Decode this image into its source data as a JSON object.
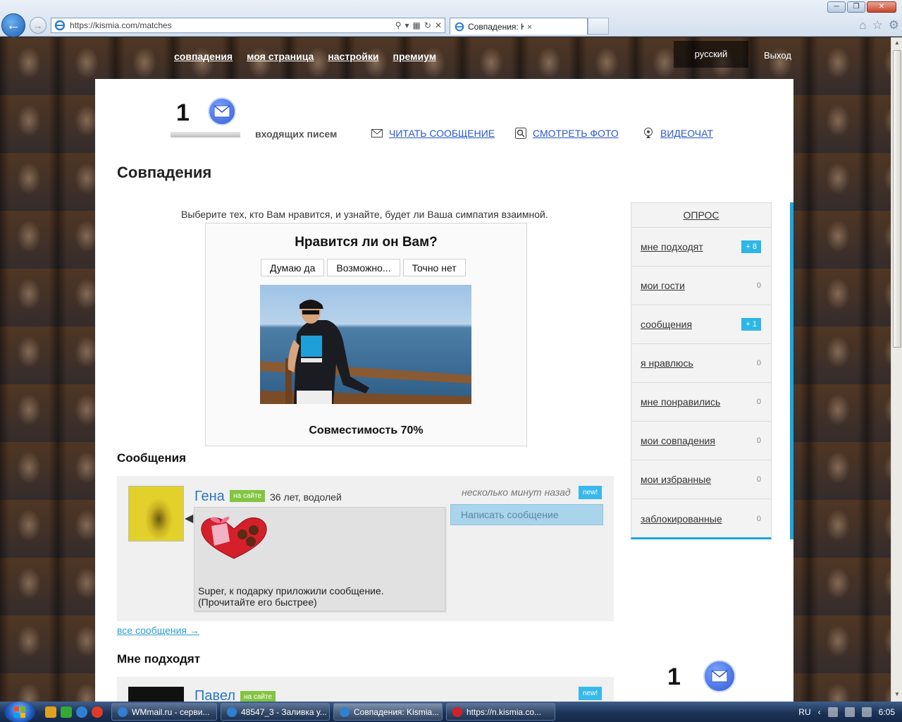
{
  "browser": {
    "url": "https://kismia.com/matches",
    "tab_title": "Совпадения: Kismia",
    "tab_close": "×"
  },
  "site": {
    "nav": [
      "совпадения",
      "моя страница",
      "настройки",
      "премиум"
    ],
    "language": "русский",
    "logout": "Выход"
  },
  "mailbox": {
    "count": "1",
    "label": "входящих писем",
    "links": {
      "read": "ЧИТАТЬ СООБЩЕНИЕ",
      "photo": "СМОТРЕТЬ ФОТО",
      "video": "ВИДЕОЧАТ"
    }
  },
  "page": {
    "title": "Совпадения",
    "intro": "Выберите тех, кто Вам нравится, и узнайте, будет ли Ваша симпатия взаимной."
  },
  "quiz": {
    "question": "Нравится ли он Вам?",
    "buttons": [
      "Думаю да",
      "Возможно...",
      "Точно нет"
    ],
    "compatibility": "Совместимость 70%"
  },
  "sidebar": {
    "title": "ОПРОС",
    "items": [
      {
        "label": "мне подходят",
        "badge": "+ 8",
        "hot": true
      },
      {
        "label": "мои гости",
        "badge": "0",
        "hot": false
      },
      {
        "label": "сообщения",
        "badge": "+ 1",
        "hot": true
      },
      {
        "label": "я нравлюсь",
        "badge": "0",
        "hot": false
      },
      {
        "label": "мне понравились",
        "badge": "0",
        "hot": false
      },
      {
        "label": "мои совпадения",
        "badge": "0",
        "hot": false
      },
      {
        "label": "мои избранные",
        "badge": "0",
        "hot": false
      },
      {
        "label": "заблокированные",
        "badge": "0",
        "hot": false
      }
    ]
  },
  "messages": {
    "heading": "Сообщения",
    "item": {
      "name": "Гена",
      "online": "на сайте",
      "info": "36 лет, водолей",
      "time": "несколько минут назад",
      "new": "new!",
      "reply": "Написать сообщение",
      "text_line1": "Super, к подарку приложили сообщение.",
      "text_line2": "(Прочитайте его быстрее)"
    },
    "all_link": "все сообщения →"
  },
  "matches": {
    "heading": "Мне подходят",
    "item": {
      "name": "Павел",
      "online": "на сайте",
      "new": "new!"
    }
  },
  "bottom_mail_count": "1",
  "taskbar": {
    "tasks": [
      {
        "label": "WMmail.ru - серви...",
        "active": false
      },
      {
        "label": "48547_3 - Заливка у...",
        "active": false
      },
      {
        "label": "Совпадения: Kismia...",
        "active": true
      },
      {
        "label": "https://n.kismia.co...",
        "active": false
      }
    ],
    "lang": "RU",
    "time": "6:05"
  },
  "colors": {
    "accent": "#1aa7dd",
    "link_blue": "#2957d0",
    "online_green": "#83c441"
  }
}
